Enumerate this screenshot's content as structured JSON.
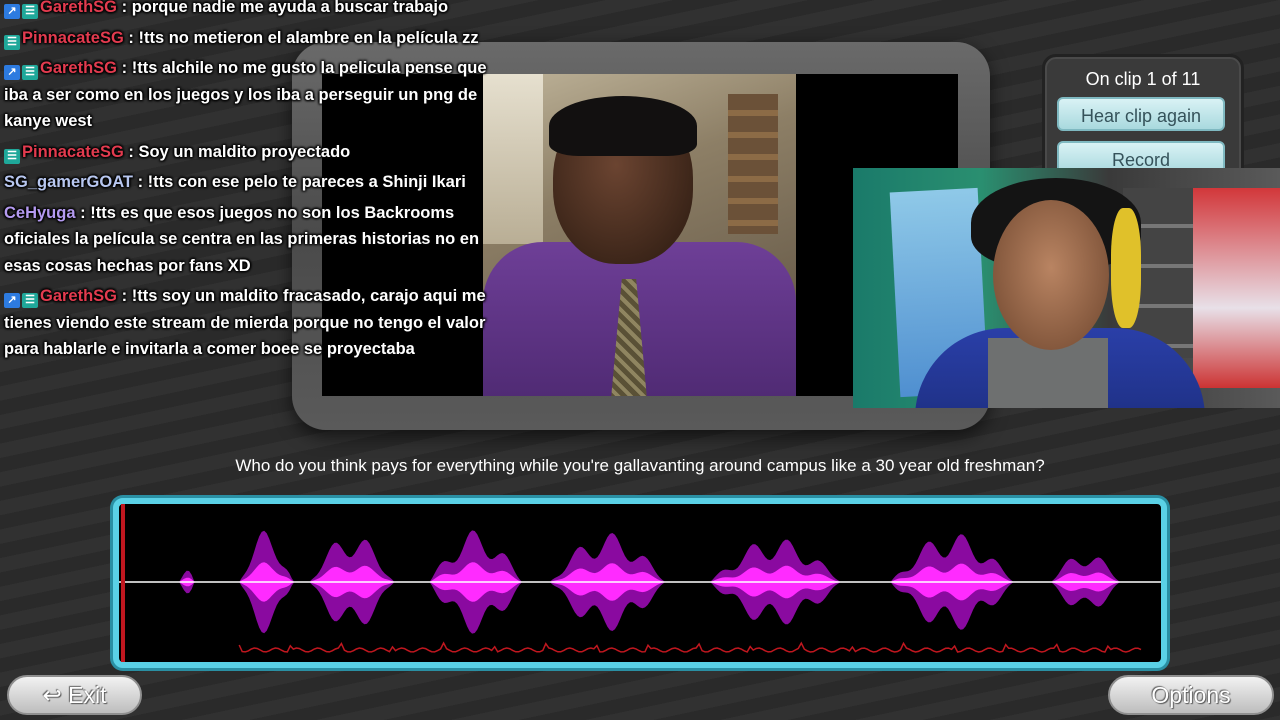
{
  "chat": {
    "messages": [
      {
        "badges": [
          "prime",
          "sub"
        ],
        "user": "GarethSG",
        "user_color": "#e33b4f",
        "text": ": porque nadie me ayuda a buscar trabajo"
      },
      {
        "badges": [
          "sub"
        ],
        "user": "PinnacateSG",
        "user_color": "#e33b4f",
        "text": ": !tts no metieron el alambre en la película zz"
      },
      {
        "badges": [
          "prime",
          "sub"
        ],
        "user": "GarethSG",
        "user_color": "#e33b4f",
        "text": ": !tts alchile no me gusto la pelicula pense que iba a ser como en los juegos y los iba a perseguir un png de kanye west"
      },
      {
        "badges": [
          "sub"
        ],
        "user": "PinnacateSG",
        "user_color": "#e33b4f",
        "text": ": Soy un maldito proyectado"
      },
      {
        "badges": [],
        "user": "SG_gamerGOAT",
        "user_color": "#b8c7f0",
        "text": ": !tts con ese pelo te pareces a Shinji Ikari"
      },
      {
        "badges": [],
        "user": "CeHyuga",
        "user_color": "#b49af0",
        "text": ": !tts es que esos juegos no son los Backrooms oficiales la película se centra en las primeras historias no en esas cosas hechas por fans XD"
      },
      {
        "badges": [
          "prime",
          "sub"
        ],
        "user": "GarethSG",
        "user_color": "#e33b4f",
        "text": ": !tts soy un maldito fracasado, carajo aqui me tienes viendo este stream de mierda porque no tengo el valor para hablarle e invitarla a comer boee se proyectaba"
      }
    ]
  },
  "clip_panel": {
    "counter": "On clip 1 of 11",
    "hear_again_label": "Hear clip again",
    "record_label": "Record"
  },
  "subtitle": "Who do you think pays for everything while you're gallavanting around campus like a 30 year old freshman?",
  "buttons": {
    "exit_label": "Exit",
    "exit_icon": "return-arrow-icon",
    "options_label": "Options"
  },
  "waveform": {
    "playhead_position": 0.0,
    "colors": {
      "frame": "#5ad1e6",
      "outer_wave": "#8a0aa0",
      "inner_wave": "#ff2bff",
      "pitch_trace": "#c0171f",
      "center_line": "#ffffff",
      "playhead": "#c0171f"
    }
  },
  "colors": {
    "accent_button": "#a9d9de",
    "background": "#2c2c2c"
  }
}
